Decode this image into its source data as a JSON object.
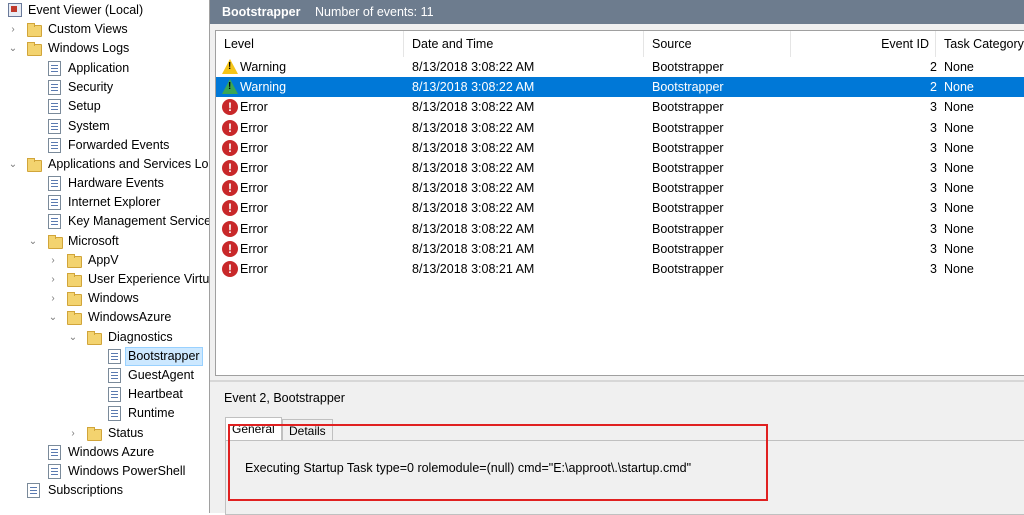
{
  "tree": {
    "root": "Event Viewer (Local)",
    "custom_views": "Custom Views",
    "windows_logs": "Windows Logs",
    "application": "Application",
    "security": "Security",
    "setup": "Setup",
    "system": "System",
    "forwarded": "Forwarded Events",
    "apps_services": "Applications and Services Lo",
    "hardware": "Hardware Events",
    "ie": "Internet Explorer",
    "kms": "Key Management Service",
    "microsoft": "Microsoft",
    "appv": "AppV",
    "uev": "User Experience Virtu",
    "windows": "Windows",
    "windowsazure": "WindowsAzure",
    "diagnostics": "Diagnostics",
    "bootstrapper": "Bootstrapper",
    "guestagent": "GuestAgent",
    "heartbeat": "Heartbeat",
    "runtime": "Runtime",
    "status": "Status",
    "windows_azure": "Windows Azure",
    "powershell": "Windows PowerShell",
    "subscriptions": "Subscriptions"
  },
  "header": {
    "log_name": "Bootstrapper",
    "count_text": "Number of events: 11"
  },
  "columns": {
    "level": "Level",
    "date": "Date and Time",
    "source": "Source",
    "event_id": "Event ID",
    "task": "Task Category"
  },
  "events": [
    {
      "level": "Warning",
      "date": "8/13/2018 3:08:22 AM",
      "source": "Bootstrapper",
      "id": "2",
      "task": "None"
    },
    {
      "level": "Warning",
      "date": "8/13/2018 3:08:22 AM",
      "source": "Bootstrapper",
      "id": "2",
      "task": "None"
    },
    {
      "level": "Error",
      "date": "8/13/2018 3:08:22 AM",
      "source": "Bootstrapper",
      "id": "3",
      "task": "None"
    },
    {
      "level": "Error",
      "date": "8/13/2018 3:08:22 AM",
      "source": "Bootstrapper",
      "id": "3",
      "task": "None"
    },
    {
      "level": "Error",
      "date": "8/13/2018 3:08:22 AM",
      "source": "Bootstrapper",
      "id": "3",
      "task": "None"
    },
    {
      "level": "Error",
      "date": "8/13/2018 3:08:22 AM",
      "source": "Bootstrapper",
      "id": "3",
      "task": "None"
    },
    {
      "level": "Error",
      "date": "8/13/2018 3:08:22 AM",
      "source": "Bootstrapper",
      "id": "3",
      "task": "None"
    },
    {
      "level": "Error",
      "date": "8/13/2018 3:08:22 AM",
      "source": "Bootstrapper",
      "id": "3",
      "task": "None"
    },
    {
      "level": "Error",
      "date": "8/13/2018 3:08:22 AM",
      "source": "Bootstrapper",
      "id": "3",
      "task": "None"
    },
    {
      "level": "Error",
      "date": "8/13/2018 3:08:21 AM",
      "source": "Bootstrapper",
      "id": "3",
      "task": "None"
    },
    {
      "level": "Error",
      "date": "8/13/2018 3:08:21 AM",
      "source": "Bootstrapper",
      "id": "3",
      "task": "None"
    }
  ],
  "detail": {
    "title": "Event 2, Bootstrapper",
    "tab_general": "General",
    "tab_details": "Details",
    "message": "Executing Startup Task type=0 rolemodule=(null) cmd=\"E:\\approot\\.\\startup.cmd\""
  },
  "colors": {
    "selection": "#0078d7",
    "header_bar": "#6d7c8e",
    "highlight_box": "#e02020"
  }
}
